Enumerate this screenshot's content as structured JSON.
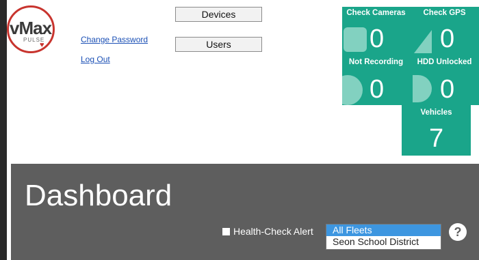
{
  "logo": {
    "word": "vMax",
    "sub": "PULSE"
  },
  "account": {
    "change_password": "Change Password",
    "log_out": "Log Out"
  },
  "nav": {
    "devices": "Devices",
    "users": "Users"
  },
  "tiles": {
    "check_cameras": {
      "label": "Check Cameras",
      "value": "0"
    },
    "check_gps": {
      "label": "Check GPS",
      "value": "0"
    },
    "not_recording": {
      "label": "Not Recording",
      "value": "0"
    },
    "hdd_unlocked": {
      "label": "HDD Unlocked",
      "value": "0"
    },
    "vehicles": {
      "label": "Vehicles",
      "value": "7"
    }
  },
  "dashboard": {
    "title": "Dashboard",
    "health_check_label": "Health-Check Alert",
    "fleets": [
      "All Fleets",
      "Seon School District"
    ],
    "help": "?"
  },
  "colors": {
    "tile": "#1aa58a",
    "dashboard_bg": "#5e5e5e",
    "selected": "#3d96e0",
    "logo_red": "#c8342e"
  }
}
